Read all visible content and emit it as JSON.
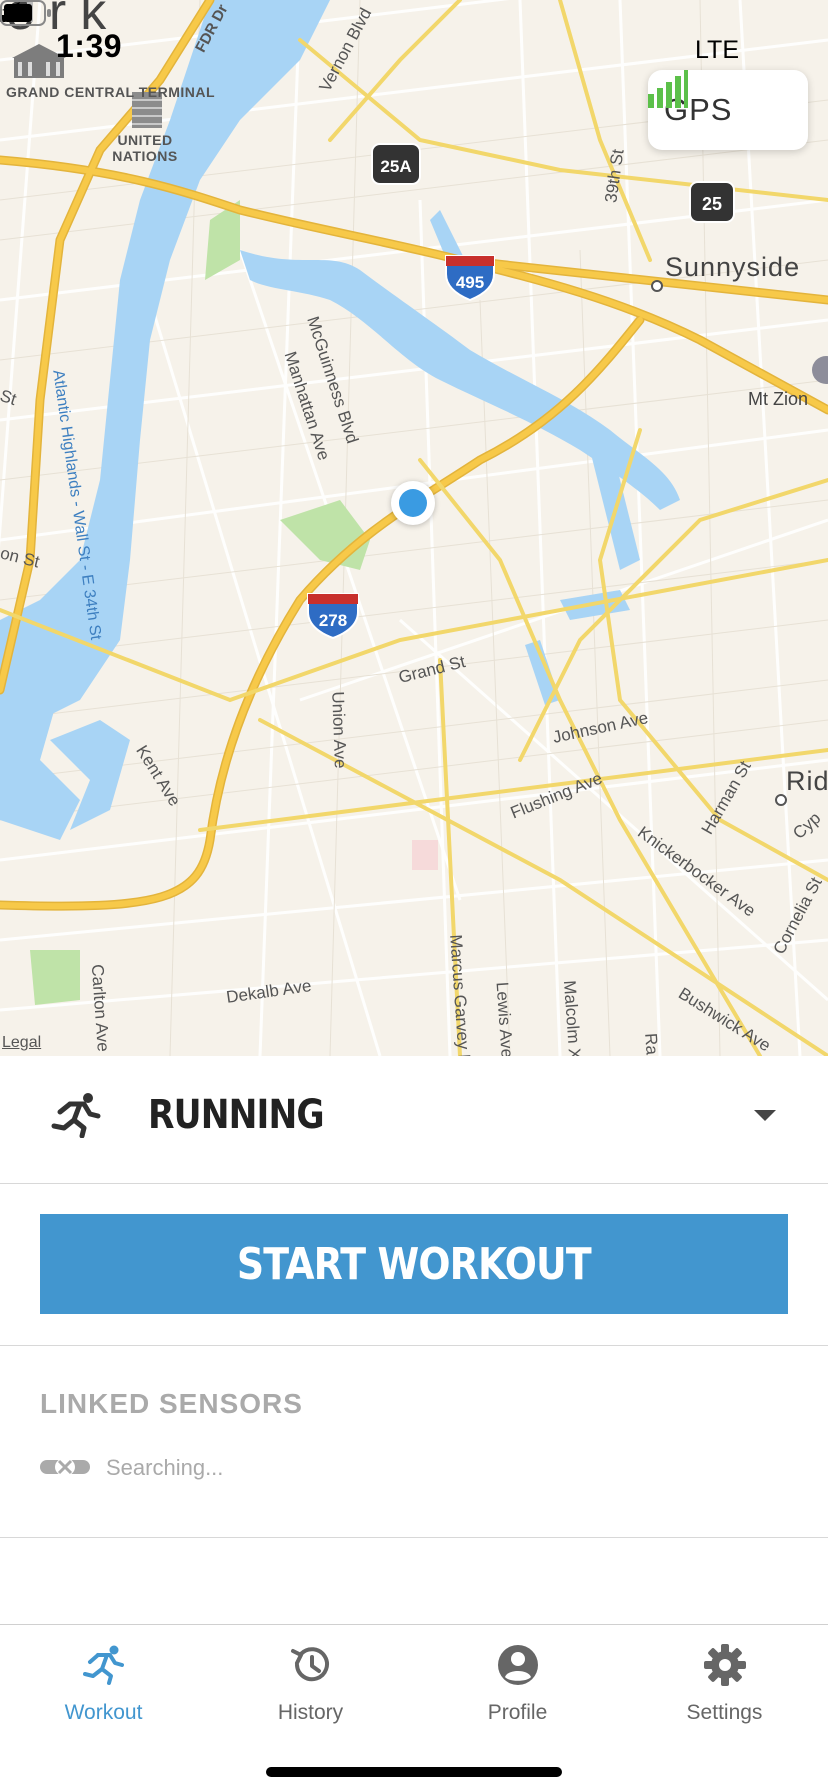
{
  "status_bar": {
    "time": "1:39",
    "network": "LTE",
    "map_partial_text": "ork"
  },
  "map": {
    "gps_label": "GPS",
    "gps_signal_bars": 4,
    "legal_label": "Legal",
    "places": [
      "Sunnyside",
      "Mt Zion",
      "Rid"
    ],
    "pois": [
      "GRAND CENTRAL TERMINAL",
      "UNITED NATIONS"
    ],
    "route_shields": [
      "25A",
      "495",
      "25",
      "278"
    ],
    "streets": [
      "FDR Dr",
      "Vernon Blvd",
      "39th St",
      "McGuinness Blvd",
      "Manhattan Ave",
      "Grand St",
      "Union Ave",
      "Kent Ave",
      "Johnson Ave",
      "Flushing Ave",
      "Harman St",
      "Knickerbocker Ave",
      "Cornelia St",
      "Cyp",
      "Bushwick Ave",
      "Dekalb Ave",
      "Carlton Ave",
      "Marcus Garvey B",
      "Lewis Ave",
      "Malcolm X",
      "Ra",
      "on St",
      "St"
    ],
    "water_label": "Atlantic Highlands - Wall St - E 34th St"
  },
  "activity": {
    "name": "RUNNING",
    "icon": "running-person-icon"
  },
  "start_button_label": "START WORKOUT",
  "sensors": {
    "title": "LINKED SENSORS",
    "status": "Searching..."
  },
  "tabs": [
    {
      "label": "Workout",
      "icon": "running-person-icon",
      "active": true
    },
    {
      "label": "History",
      "icon": "history-clock-icon",
      "active": false
    },
    {
      "label": "Profile",
      "icon": "profile-icon",
      "active": false
    },
    {
      "label": "Settings",
      "icon": "gear-icon",
      "active": false
    }
  ],
  "colors": {
    "accent": "#4296cf",
    "water": "#a8d4f5",
    "highway": "#f7c949",
    "park": "#bfe3a8",
    "user_dot": "#3a9be2",
    "gps_bars": "#5cc04a"
  }
}
